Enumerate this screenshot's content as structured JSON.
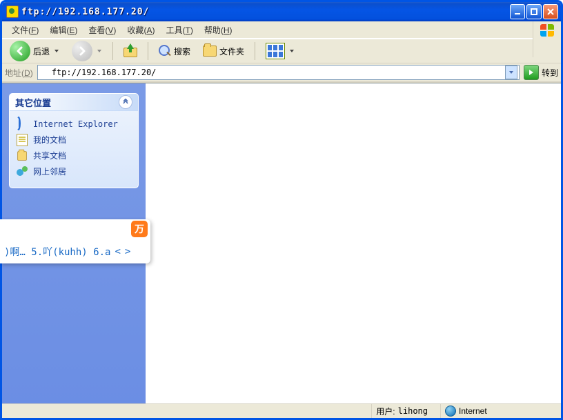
{
  "title": "ftp://192.168.177.20/",
  "menu": {
    "file": {
      "label": "文件",
      "accel": "F"
    },
    "edit": {
      "label": "编辑",
      "accel": "E"
    },
    "view": {
      "label": "查看",
      "accel": "V"
    },
    "fav": {
      "label": "收藏",
      "accel": "A"
    },
    "tools": {
      "label": "工具",
      "accel": "T"
    },
    "help": {
      "label": "帮助",
      "accel": "H"
    }
  },
  "toolbar": {
    "back": "后退",
    "search": "搜索",
    "folders": "文件夹"
  },
  "addressbar": {
    "label": "地址",
    "accel": "D",
    "value": "ftp://192.168.177.20/",
    "go": "转到"
  },
  "sidebar": {
    "panel_title": "其它位置",
    "links": [
      {
        "icon": "ie-icon",
        "label": "Internet Explorer"
      },
      {
        "icon": "documents-icon",
        "label": "我的文档"
      },
      {
        "icon": "folder-icon",
        "label": "共享文档"
      },
      {
        "icon": "network-icon",
        "label": "网上邻居"
      }
    ]
  },
  "ime": {
    "candidates": ")啊…  5.吖(kuhh)  6.a"
  },
  "statusbar": {
    "user_label": "用户:",
    "user_value": "lihong",
    "zone": "Internet"
  }
}
